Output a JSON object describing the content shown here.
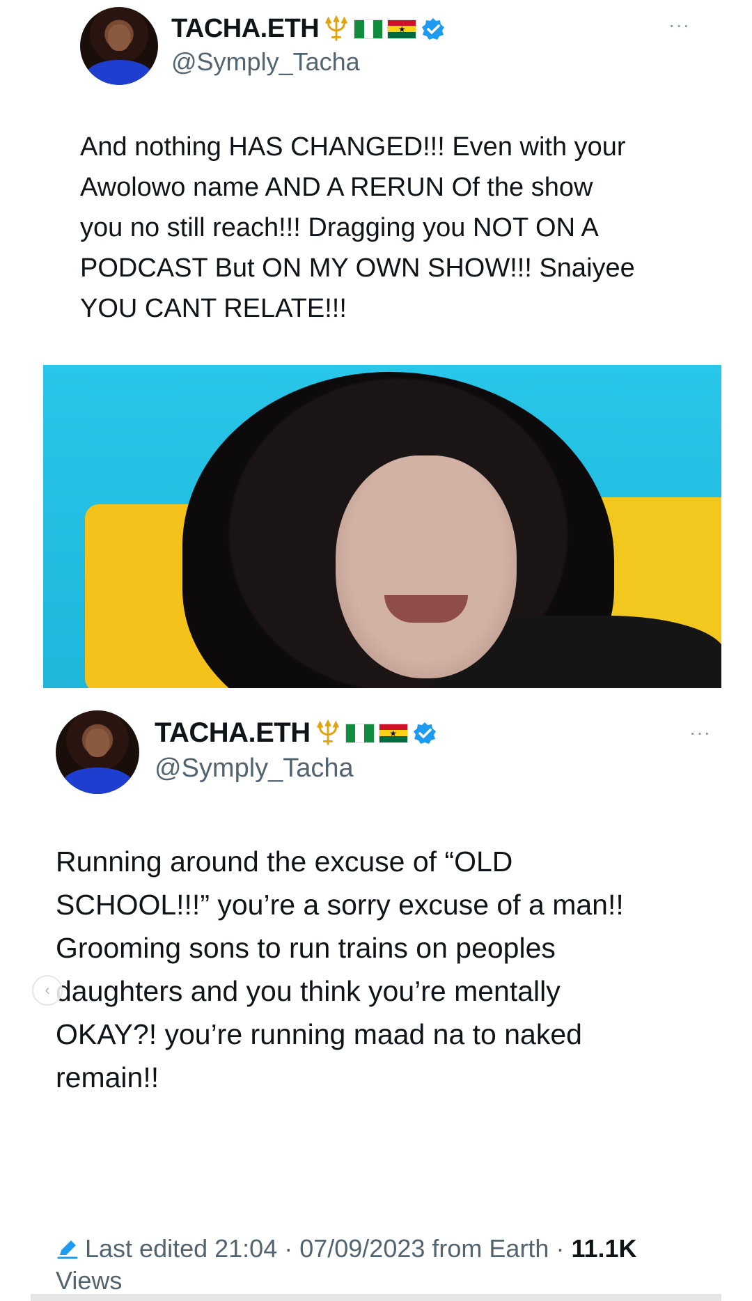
{
  "tweets": [
    {
      "display_name": "TACHA.ETH",
      "handle": "@Symply_Tacha",
      "text": "And nothing HAS CHANGED!!! Even with your\nAwolowo name AND A RERUN Of the show\nyou no still reach!!! Dragging you NOT ON A\nPODCAST But ON MY OWN SHOW!!! Snaiyee\nYOU CANT RELATE!!!",
      "more": "···"
    },
    {
      "display_name": "TACHA.ETH",
      "handle": "@Symply_Tacha",
      "text": "Running around the excuse of “OLD\nSCHOOL!!!” you’re a sorry excuse of a man!!\nGrooming sons to run trains on peoples\ndaughters and you think you’re mentally\nOKAY?! you’re running maad na to naked\nremain!!",
      "more": "···"
    }
  ],
  "footer": {
    "edited": "Last edited 21:04 · 07/09/2023",
    "source": "from Earth ·",
    "views_count": "11.1K",
    "views_label": "Views"
  },
  "colors": {
    "verified": "#1d9bf0",
    "handle": "#536471",
    "media_bg": "#28c6e8"
  },
  "icons": [
    "trident-emoji",
    "nigeria-flag",
    "ghana-flag",
    "verified-badge",
    "more-icon",
    "edit-icon"
  ]
}
